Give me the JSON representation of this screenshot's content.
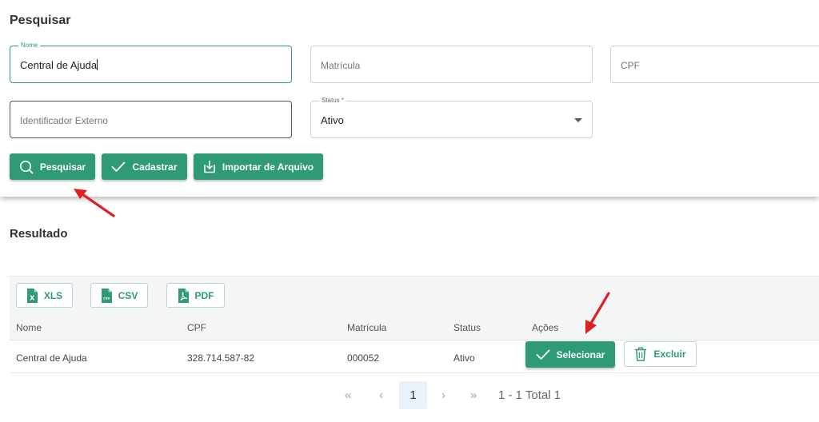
{
  "search": {
    "title": "Pesquisar",
    "fields": {
      "nome": {
        "label": "Nome",
        "value": "Central de Ajuda"
      },
      "matricula": {
        "placeholder": "Matrícula"
      },
      "cpf": {
        "placeholder": "CPF"
      },
      "identificador": {
        "placeholder": "Identificador Externo"
      },
      "status": {
        "label": "Status *",
        "value": "Ativo"
      }
    },
    "buttons": {
      "pesquisar": "Pesquisar",
      "cadastrar": "Cadastrar",
      "importar": "Importar de Arquivo"
    }
  },
  "results": {
    "title": "Resultado",
    "export": {
      "xls": "XLS",
      "csv": "CSV",
      "pdf": "PDF",
      "csv_icon_text": "csv"
    },
    "columns": [
      "Nome",
      "CPF",
      "Matrícula",
      "Status",
      "Ações"
    ],
    "rows": [
      {
        "nome": "Central de Ajuda",
        "cpf": "328.714.587-82",
        "matricula": "000052",
        "status": "Ativo",
        "actions": {
          "select": "Selecionar",
          "delete": "Excluir"
        }
      }
    ],
    "pagination": {
      "first": "«",
      "prev": "‹",
      "current": "1",
      "next": "›",
      "last": "»",
      "summary": "1 - 1 Total 1"
    }
  },
  "colors": {
    "primary": "#2e9b74",
    "arrow": "#e02020"
  },
  "icons": [
    "search-icon",
    "check-icon",
    "import-icon",
    "excel-icon",
    "csv-file-icon",
    "pdf-icon",
    "trash-icon",
    "chevron-down-icon"
  ]
}
